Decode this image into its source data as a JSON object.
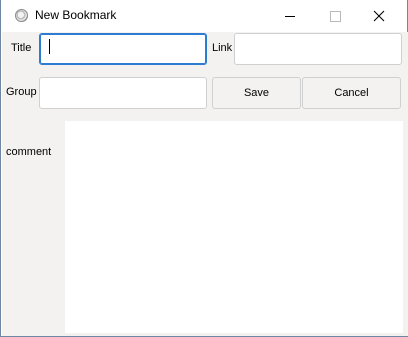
{
  "window": {
    "title": "New Bookmark",
    "icon": "app-disc-icon",
    "controls": {
      "minimize": "minimize-icon",
      "maximize": "maximize-icon",
      "close": "close-icon"
    }
  },
  "form": {
    "title_label": "Title",
    "title_value": "",
    "link_label": "Link",
    "link_value": "",
    "group_label": "Group",
    "group_value": "",
    "save_label": "Save",
    "cancel_label": "Cancel",
    "comment_label": "comment",
    "comment_value": ""
  },
  "colors": {
    "focus_accent": "#2d7cd1",
    "panel_background": "#f3f2f1",
    "desktop_background": "#2b5a86"
  }
}
